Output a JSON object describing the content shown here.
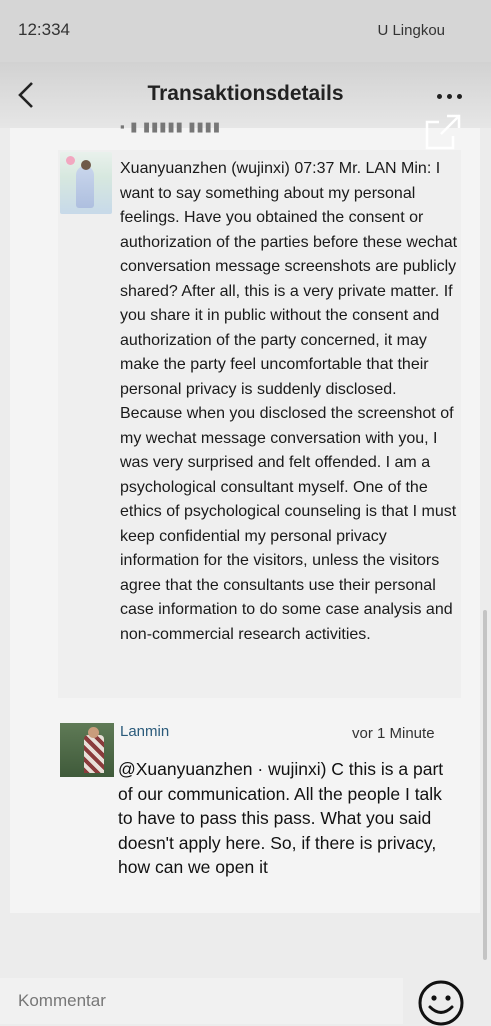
{
  "status": {
    "time": "12:334",
    "carrier": "U Lingkou"
  },
  "header": {
    "title": "Transaktionsdetails"
  },
  "post": {
    "message": "Xuanyuanzhen (wujinxi) 07:37 Mr. LAN Min: I want to say something about my personal feelings. Have you obtained the consent or authorization of the parties before these wechat conversation message screenshots are publicly shared? After all, this is a very private matter. If you share it in public without the consent and authorization of the party concerned, it may make the party feel uncomfortable that their personal privacy is suddenly disclosed. Because when you disclosed the screenshot of my wechat message conversation with you, I was very surprised and felt offended. I am a psychological consultant myself. One of the ethics of psychological counseling is that I must keep confidential my personal privacy information for the visitors, unless the visitors agree that the consultants use their personal case information to do some case analysis and non-commercial research activities."
  },
  "comment": {
    "author": "Lanmin",
    "time": "vor 1 Minute",
    "text": "@Xuanyuanzhen · wujinxi) C this is a part of our communication. All the people I talk to have to pass this pass. What you said doesn't apply here. So, if there is privacy, how can we open it"
  },
  "footer": {
    "placeholder": "Kommentar"
  },
  "icons": {
    "back": "chevron-left-icon",
    "more": "more-dots-icon",
    "share": "share-icon",
    "emoji": "emoji-icon"
  }
}
